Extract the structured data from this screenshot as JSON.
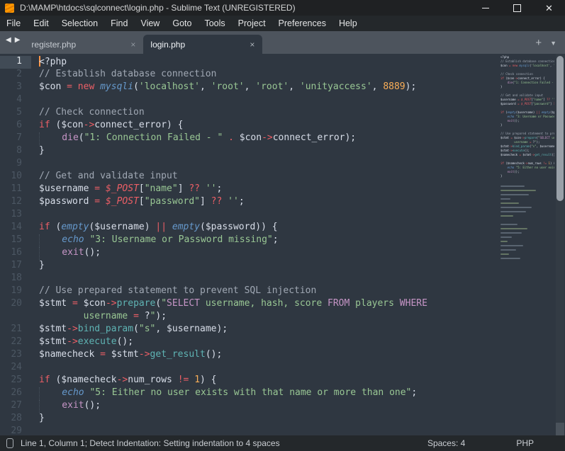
{
  "window": {
    "title": "D:\\MAMP\\htdocs\\sqlconnect\\login.php - Sublime Text (UNREGISTERED)"
  },
  "icons": {
    "minimize": "minimize-bar",
    "maximize": "maximize-square",
    "close": "✕",
    "nav_back": "◀",
    "nav_forward": "▶",
    "tab_close": "×",
    "new_tab": "+",
    "tab_overflow": "▼"
  },
  "colors": {
    "editor_bg": "#2f3741",
    "tabbar_bg": "#4d545d",
    "chrome_bg": "#24282b",
    "accent_orange": "#ff9800",
    "caret": "#fb9547",
    "string_green": "#99c794",
    "keyword_red": "#ec5f66",
    "number_orange": "#f9ae58",
    "func_teal": "#5fb4b4",
    "sql_purple": "#c695c6",
    "builtin_blue": "#6699cc",
    "comment_gray": "#a0a8b4"
  },
  "menu": {
    "items": [
      "File",
      "Edit",
      "Selection",
      "Find",
      "View",
      "Goto",
      "Tools",
      "Project",
      "Preferences",
      "Help"
    ]
  },
  "tabs": {
    "items": [
      {
        "label": "register.php",
        "active": false
      },
      {
        "label": "login.php",
        "active": true
      }
    ]
  },
  "editor": {
    "lines": [
      {
        "n": "1",
        "cur": true,
        "caret": true,
        "t": [
          [
            "<?php",
            "fg"
          ]
        ]
      },
      {
        "n": "2",
        "t": [
          [
            "// Establish database connection",
            "com"
          ]
        ]
      },
      {
        "n": "3",
        "t": [
          [
            "$con ",
            "fg"
          ],
          [
            "=",
            "red"
          ],
          [
            " ",
            "fg"
          ],
          [
            "new",
            "red"
          ],
          [
            " ",
            "fg"
          ],
          [
            "mysqli",
            "blu"
          ],
          [
            "(",
            "fg"
          ],
          [
            "'localhost'",
            "grn"
          ],
          [
            ", ",
            "fg"
          ],
          [
            "'root'",
            "grn"
          ],
          [
            ", ",
            "fg"
          ],
          [
            "'root'",
            "grn"
          ],
          [
            ", ",
            "fg"
          ],
          [
            "'unityaccess'",
            "grn"
          ],
          [
            ", ",
            "fg"
          ],
          [
            "8889",
            "org"
          ],
          [
            ");",
            "fg"
          ]
        ]
      },
      {
        "n": "4",
        "t": []
      },
      {
        "n": "5",
        "t": [
          [
            "// Check connection",
            "com"
          ]
        ]
      },
      {
        "n": "6",
        "t": [
          [
            "if",
            "red"
          ],
          [
            " (",
            "fg"
          ],
          [
            "$con",
            "fg"
          ],
          [
            "->",
            "red"
          ],
          [
            "connect_error",
            "fg"
          ],
          [
            ") {",
            "fg"
          ]
        ]
      },
      {
        "n": "7",
        "t": [
          [
            "",
            "ind"
          ],
          [
            "die",
            "pur"
          ],
          [
            "(",
            "fg"
          ],
          [
            "\"1: Connection Failed - \"",
            "grn"
          ],
          [
            " ",
            "fg"
          ],
          [
            ".",
            "red"
          ],
          [
            " ",
            "fg"
          ],
          [
            "$con",
            "fg"
          ],
          [
            "->",
            "red"
          ],
          [
            "connect_error",
            "fg"
          ],
          [
            ");",
            "fg"
          ]
        ]
      },
      {
        "n": "8",
        "t": [
          [
            "}",
            "fg"
          ]
        ]
      },
      {
        "n": "9",
        "t": []
      },
      {
        "n": "10",
        "t": [
          [
            "// Get and validate input",
            "com"
          ]
        ]
      },
      {
        "n": "11",
        "t": [
          [
            "$username ",
            "fg"
          ],
          [
            "=",
            "red"
          ],
          [
            " ",
            "fg"
          ],
          [
            "$_POST",
            "redi"
          ],
          [
            "[",
            "fg"
          ],
          [
            "\"name\"",
            "grn"
          ],
          [
            "] ",
            "fg"
          ],
          [
            "??",
            "red"
          ],
          [
            " ",
            "fg"
          ],
          [
            "''",
            "grn"
          ],
          [
            ";",
            "fg"
          ]
        ]
      },
      {
        "n": "12",
        "t": [
          [
            "$password ",
            "fg"
          ],
          [
            "=",
            "red"
          ],
          [
            " ",
            "fg"
          ],
          [
            "$_POST",
            "redi"
          ],
          [
            "[",
            "fg"
          ],
          [
            "\"password\"",
            "grn"
          ],
          [
            "] ",
            "fg"
          ],
          [
            "??",
            "red"
          ],
          [
            " ",
            "fg"
          ],
          [
            "''",
            "grn"
          ],
          [
            ";",
            "fg"
          ]
        ]
      },
      {
        "n": "13",
        "t": []
      },
      {
        "n": "14",
        "t": [
          [
            "if",
            "red"
          ],
          [
            " (",
            "fg"
          ],
          [
            "empty",
            "blu"
          ],
          [
            "(",
            "fg"
          ],
          [
            "$username",
            "fg"
          ],
          [
            ") ",
            "fg"
          ],
          [
            "||",
            "red"
          ],
          [
            " ",
            "fg"
          ],
          [
            "empty",
            "blu"
          ],
          [
            "(",
            "fg"
          ],
          [
            "$password",
            "fg"
          ],
          [
            ")) {",
            "fg"
          ]
        ]
      },
      {
        "n": "15",
        "t": [
          [
            "",
            "ind"
          ],
          [
            "echo",
            "blu"
          ],
          [
            " ",
            "fg"
          ],
          [
            "\"3: Username or Password missing\"",
            "grn"
          ],
          [
            ";",
            "fg"
          ]
        ]
      },
      {
        "n": "16",
        "t": [
          [
            "",
            "ind"
          ],
          [
            "exit",
            "pur"
          ],
          [
            "();",
            "fg"
          ]
        ]
      },
      {
        "n": "17",
        "t": [
          [
            "}",
            "fg"
          ]
        ]
      },
      {
        "n": "18",
        "t": []
      },
      {
        "n": "19",
        "t": [
          [
            "// Use prepared statement to prevent SQL injection",
            "com"
          ]
        ]
      },
      {
        "n": "20",
        "t": [
          [
            "$stmt ",
            "fg"
          ],
          [
            "=",
            "red"
          ],
          [
            " ",
            "fg"
          ],
          [
            "$con",
            "fg"
          ],
          [
            "->",
            "red"
          ],
          [
            "prepare",
            "tea"
          ],
          [
            "(",
            "fg"
          ],
          [
            "\"",
            "grn"
          ],
          [
            "SELECT",
            "pur"
          ],
          [
            " username, hash, score ",
            "grn"
          ],
          [
            "FROM",
            "pur"
          ],
          [
            " players ",
            "grn"
          ],
          [
            "WHERE",
            "pur"
          ]
        ]
      },
      {
        "n": "",
        "t": [
          [
            "        ",
            "fg"
          ],
          [
            "username ",
            "grn"
          ],
          [
            "=",
            "red"
          ],
          [
            " ?",
            "fg"
          ],
          [
            "\"",
            "grn"
          ],
          [
            ");",
            "fg"
          ]
        ]
      },
      {
        "n": "21",
        "t": [
          [
            "$stmt",
            "fg"
          ],
          [
            "->",
            "red"
          ],
          [
            "bind_param",
            "tea"
          ],
          [
            "(",
            "fg"
          ],
          [
            "\"s\"",
            "grn"
          ],
          [
            ", ",
            "fg"
          ],
          [
            "$username",
            "fg"
          ],
          [
            ");",
            "fg"
          ]
        ]
      },
      {
        "n": "22",
        "t": [
          [
            "$stmt",
            "fg"
          ],
          [
            "->",
            "red"
          ],
          [
            "execute",
            "tea"
          ],
          [
            "();",
            "fg"
          ]
        ]
      },
      {
        "n": "23",
        "t": [
          [
            "$namecheck ",
            "fg"
          ],
          [
            "=",
            "red"
          ],
          [
            " ",
            "fg"
          ],
          [
            "$stmt",
            "fg"
          ],
          [
            "->",
            "red"
          ],
          [
            "get_result",
            "tea"
          ],
          [
            "();",
            "fg"
          ]
        ]
      },
      {
        "n": "24",
        "t": []
      },
      {
        "n": "25",
        "t": [
          [
            "if",
            "red"
          ],
          [
            " (",
            "fg"
          ],
          [
            "$namecheck",
            "fg"
          ],
          [
            "->",
            "red"
          ],
          [
            "num_rows ",
            "fg"
          ],
          [
            "!=",
            "red"
          ],
          [
            " ",
            "fg"
          ],
          [
            "1",
            "org"
          ],
          [
            ") {",
            "fg"
          ]
        ]
      },
      {
        "n": "26",
        "t": [
          [
            "",
            "ind"
          ],
          [
            "echo",
            "blu"
          ],
          [
            " ",
            "fg"
          ],
          [
            "\"5: Either no user exists with that name or more than one\"",
            "grn"
          ],
          [
            ";",
            "fg"
          ]
        ]
      },
      {
        "n": "27",
        "t": [
          [
            "",
            "ind"
          ],
          [
            "exit",
            "pur"
          ],
          [
            "();",
            "fg"
          ]
        ]
      },
      {
        "n": "28",
        "t": [
          [
            "}",
            "fg"
          ]
        ]
      },
      {
        "n": "29",
        "t": []
      }
    ]
  },
  "statusbar": {
    "left_text": "Line 1, Column 1; Detect Indentation: Setting indentation to 4 spaces",
    "spaces": "Spaces: 4",
    "syntax": "PHP"
  }
}
